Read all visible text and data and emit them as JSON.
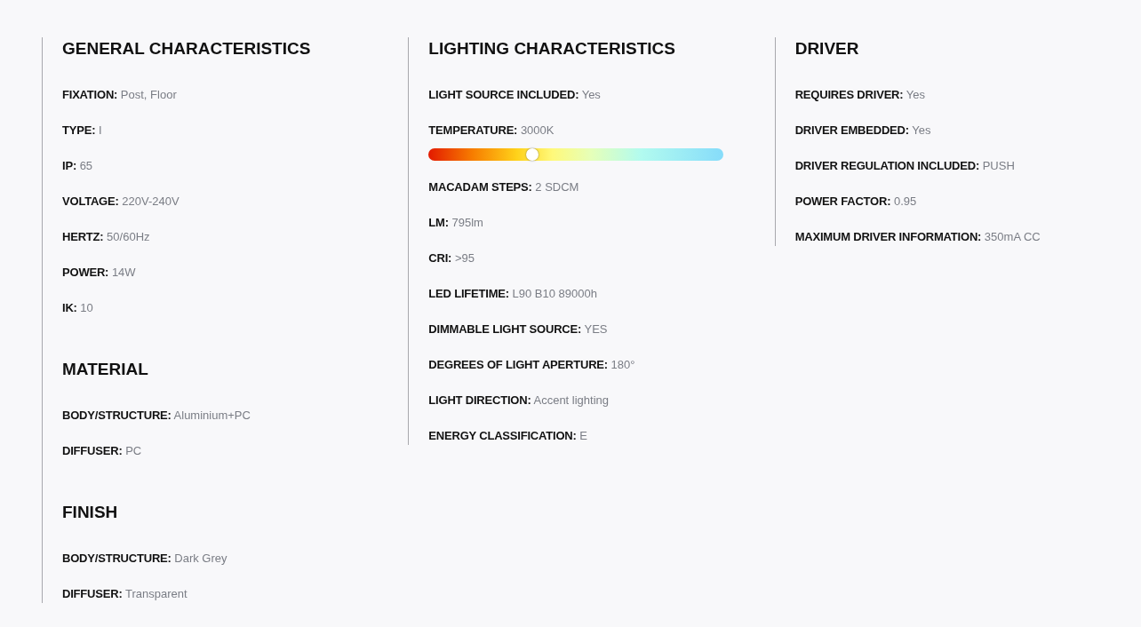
{
  "columns": [
    {
      "sections": [
        {
          "title": "GENERAL CHARACTERISTICS",
          "rows": [
            {
              "kind": "text",
              "label": "FIXATION:",
              "value": "Post, Floor"
            },
            {
              "kind": "text",
              "label": "TYPE:",
              "value": "I"
            },
            {
              "kind": "text",
              "label": "IP:",
              "value": "65"
            },
            {
              "kind": "text",
              "label": "VOLTAGE:",
              "value": "220V-240V"
            },
            {
              "kind": "text",
              "label": "HERTZ:",
              "value": "50/60Hz"
            },
            {
              "kind": "text",
              "label": "POWER:",
              "value": "14W"
            },
            {
              "kind": "text",
              "label": "IK:",
              "value": "10"
            }
          ]
        },
        {
          "title": "MATERIAL",
          "rows": [
            {
              "kind": "text",
              "label": "BODY/STRUCTURE:",
              "value": "Aluminium+PC"
            },
            {
              "kind": "text",
              "label": "DIFFUSER:",
              "value": "PC"
            }
          ]
        },
        {
          "title": "FINISH",
          "rows": [
            {
              "kind": "text",
              "label": "BODY/STRUCTURE:",
              "value": "Dark Grey"
            },
            {
              "kind": "text",
              "label": "DIFFUSER:",
              "value": "Transparent"
            }
          ]
        }
      ]
    },
    {
      "sections": [
        {
          "title": "LIGHTING CHARACTERISTICS",
          "rows": [
            {
              "kind": "text",
              "label": "LIGHT SOURCE INCLUDED:",
              "value": "Yes"
            },
            {
              "kind": "slider",
              "label": "TEMPERATURE:",
              "value": "3000K",
              "level": 0.35
            },
            {
              "kind": "text",
              "label": "MACADAM STEPS:",
              "value": "2 SDCM"
            },
            {
              "kind": "text",
              "label": "LM:",
              "value": "795lm"
            },
            {
              "kind": "text",
              "label": "CRI:",
              "value": ">95"
            },
            {
              "kind": "text",
              "label": "LED LIFETIME:",
              "value": "L90 B10 89000h"
            },
            {
              "kind": "text",
              "label": "DIMMABLE LIGHT SOURCE:",
              "value": "YES"
            },
            {
              "kind": "text",
              "label": "DEGREES OF LIGHT APERTURE:",
              "value": "180°"
            },
            {
              "kind": "text",
              "label": "LIGHT DIRECTION:",
              "value": "Accent lighting"
            },
            {
              "kind": "text",
              "label": "ENERGY CLASSIFICATION:",
              "value": "E"
            }
          ]
        }
      ]
    },
    {
      "sections": [
        {
          "title": "DRIVER",
          "rows": [
            {
              "kind": "text",
              "label": "REQUIRES DRIVER:",
              "value": "Yes"
            },
            {
              "kind": "text",
              "label": "DRIVER EMBEDDED:",
              "value": "Yes"
            },
            {
              "kind": "text",
              "label": "DRIVER REGULATION INCLUDED:",
              "value": "PUSH"
            },
            {
              "kind": "text",
              "label": "POWER FACTOR:",
              "value": "0.95"
            },
            {
              "kind": "text",
              "label": "MAXIMUM DRIVER INFORMATION:",
              "value": "350mA CC"
            }
          ]
        }
      ]
    }
  ]
}
